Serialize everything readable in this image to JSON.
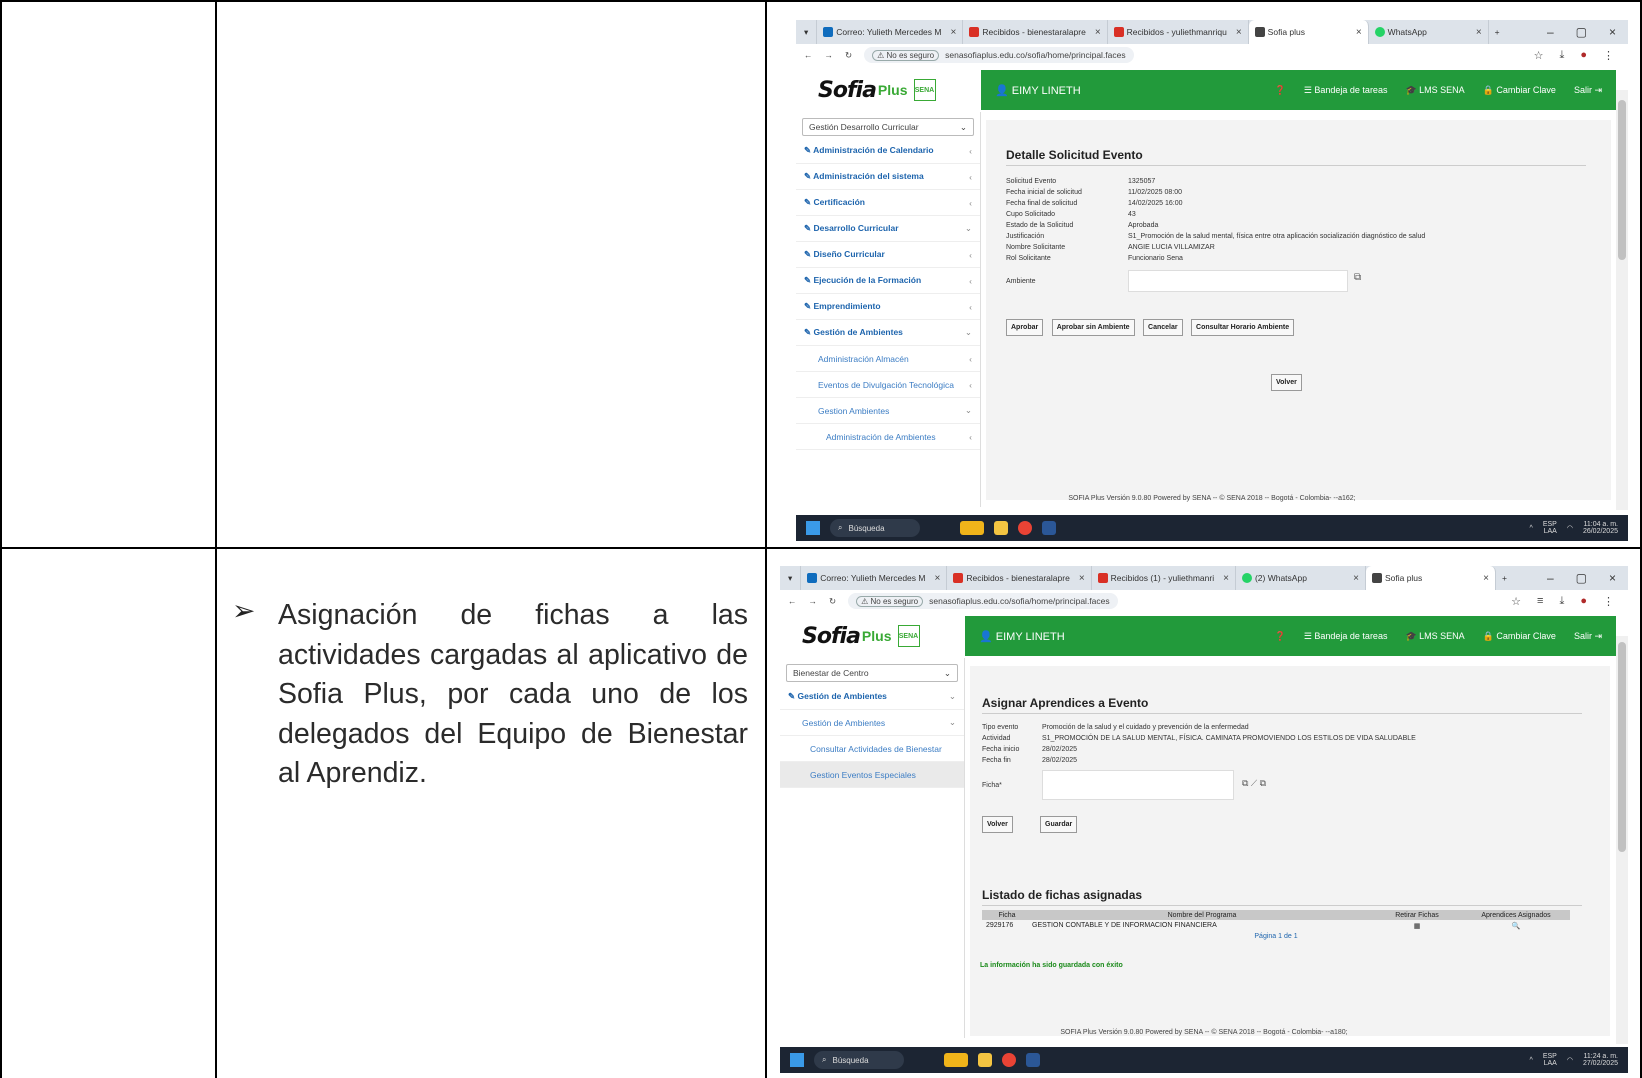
{
  "bullet": {
    "text": "Asignación de fichas a las actividades cargadas al aplicativo de Sofia Plus, por cada uno de los delegados del Equipo de Bienestar al Aprendiz."
  },
  "shot1": {
    "tabs": [
      {
        "label": "Correo: Yulieth Mercedes M",
        "color": "#0f6cbd"
      },
      {
        "label": "Recibidos - bienestaralapre",
        "color": "#d93025"
      },
      {
        "label": "Recibidos - yuliethmanriqu",
        "color": "#d93025"
      },
      {
        "label": "Sofia plus",
        "color": "#444444"
      },
      {
        "label": "WhatsApp",
        "color": "#25d366"
      }
    ],
    "insecure_label": "No es seguro",
    "url": "senasofiaplus.edu.co/sofia/home/principal.faces",
    "user": "EIMY LINETH",
    "menu": [
      "Bandeja de tareas",
      "LMS SENA",
      "Cambiar Clave",
      "Salir"
    ],
    "select": "Gestión Desarrollo Curricular",
    "side_items": [
      "Administración de Calendario",
      "Administración del sistema",
      "Certificación",
      "Desarrollo Curricular",
      "Diseño Curricular",
      "Ejecución de la Formación",
      "Emprendimiento",
      "Gestión de Ambientes"
    ],
    "side_sub": [
      "Administración Almacén",
      "Eventos de Divulgación Tecnológica",
      "Gestion Ambientes"
    ],
    "side_sub2": "Administración de Ambientes",
    "title": "Detalle Solicitud Evento",
    "rows": [
      {
        "label": "Solicitud Evento",
        "value": "1325057"
      },
      {
        "label": "Fecha inicial de solicitud",
        "value": "11/02/2025 08:00"
      },
      {
        "label": "Fecha final de solicitud",
        "value": "14/02/2025 16:00"
      },
      {
        "label": "Cupo Solicitado",
        "value": "43"
      },
      {
        "label": "Estado de la Solicitud",
        "value": "Aprobada"
      },
      {
        "label": "Justificación",
        "value": "S1_Promoción de la salud mental, física entre otra aplicación socialización diagnóstico de salud"
      },
      {
        "label": "Nombre Solicitante",
        "value": "ANGIE LUCIA VILLAMIZAR"
      },
      {
        "label": "Rol Solicitante",
        "value": "Funcionario Sena"
      }
    ],
    "ambiente_label": "Ambiente",
    "buttons": [
      "Aprobar",
      "Aprobar sin Ambiente",
      "Cancelar",
      "Consultar Horario Ambiente"
    ],
    "volver": "Volver",
    "footer": "SOFIA Plus Versión 9.0.80 Powered by SENA -- © SENA 2018 -- Bogotá - Colombia- --a162;",
    "search": "Búsqueda",
    "lang": "ESP",
    "lang2": "LAA",
    "time": "11:04 a. m.",
    "date": "26/02/2025"
  },
  "shot2": {
    "tabs": [
      {
        "label": "Correo: Yulieth Mercedes M",
        "color": "#0f6cbd"
      },
      {
        "label": "Recibidos - bienestaralapre",
        "color": "#d93025"
      },
      {
        "label": "Recibidos (1) - yuliethmanri",
        "color": "#d93025"
      },
      {
        "label": "(2) WhatsApp",
        "color": "#25d366"
      },
      {
        "label": "Sofia plus",
        "color": "#444444"
      }
    ],
    "insecure_label": "No es seguro",
    "url": "senasofiaplus.edu.co/sofia/home/principal.faces",
    "user": "EIMY LINETH",
    "menu": [
      "Bandeja de tareas",
      "LMS SENA",
      "Cambiar Clave",
      "Salir"
    ],
    "select": "Bienestar de Centro",
    "side_items": [
      "Gestión de Ambientes"
    ],
    "side_sub": [
      "Gestión de Ambientes"
    ],
    "side_sub2": [
      "Consultar Actividades de Bienestar",
      "Gestion Eventos Especiales"
    ],
    "title": "Asignar Aprendices a Evento",
    "rows": [
      {
        "label": "Tipo evento",
        "value": "Promoción de la salud y el cuidado y prevención de la enfermedad"
      },
      {
        "label": "Actividad",
        "value": "S1_PROMOCIÓN DE LA SALUD MENTAL, FÍSICA. CAMINATA PROMOVIENDO LOS ESTILOS DE VIDA SALUDABLE"
      },
      {
        "label": "Fecha inicio",
        "value": "28/02/2025"
      },
      {
        "label": "Fecha fin",
        "value": "28/02/2025"
      }
    ],
    "ficha_label": "Ficha*",
    "volver": "Volver",
    "guardar": "Guardar",
    "list_title": "Listado de fichas asignadas",
    "columns": [
      "Ficha",
      "Nombre del Programa",
      "Retirar Fichas",
      "Aprendices Asignados"
    ],
    "row": {
      "ficha": "2929176",
      "programa": "GESTION CONTABLE Y DE INFORMACION FINANCIERA"
    },
    "pagina": "Página 1 de 1",
    "success": "La información ha sido guardada con éxito",
    "footer": "SOFIA Plus Versión 9.0.80 Powered by SENA -- © SENA 2018 -- Bogotá - Colombia- --a180;",
    "search": "Búsqueda",
    "lang": "ESP",
    "lang2": "LAA",
    "time": "11:24 a. m.",
    "date": "27/02/2025"
  },
  "colors": {
    "green": "#229a3b",
    "link_blue": "#1d64ad",
    "success_green": "#1a8a1a"
  }
}
